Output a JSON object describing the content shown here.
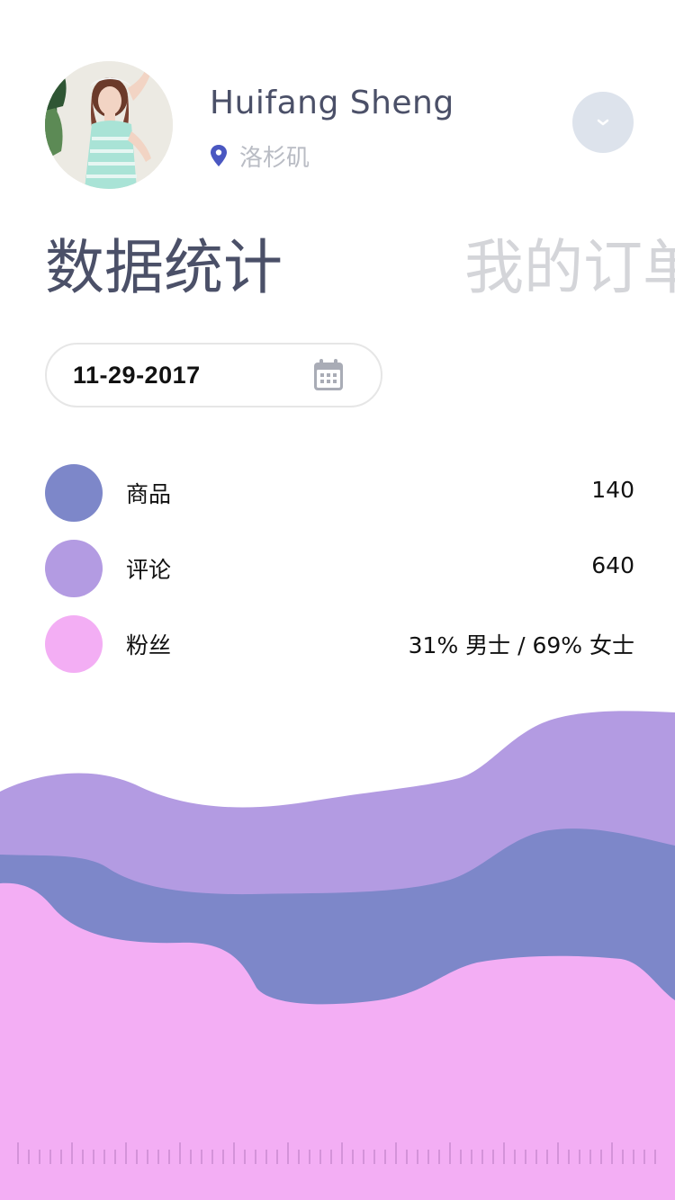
{
  "profile": {
    "name": "Huifang Sheng",
    "location": "洛杉矶"
  },
  "tabs": [
    {
      "label": "数据统计",
      "active": true
    },
    {
      "label": "我的订单",
      "active": false
    }
  ],
  "date_picker": {
    "value": "11-29-2017"
  },
  "stats": [
    {
      "label": "商品",
      "value": "140",
      "color": "#7d87c9"
    },
    {
      "label": "评论",
      "value": "640",
      "color": "#b39be2"
    },
    {
      "label": "粉丝",
      "value": "31% 男士 /  69% 女士",
      "color": "#f3aef4"
    }
  ],
  "colors": {
    "title": "#4b5068",
    "inactive_tab": "#d4d5d9",
    "pin": "#4a57c1",
    "dropdown_bg": "#dde3ec"
  },
  "icons": {
    "location": "map-pin-icon",
    "dropdown": "chevron-down-icon",
    "calendar": "calendar-icon"
  }
}
